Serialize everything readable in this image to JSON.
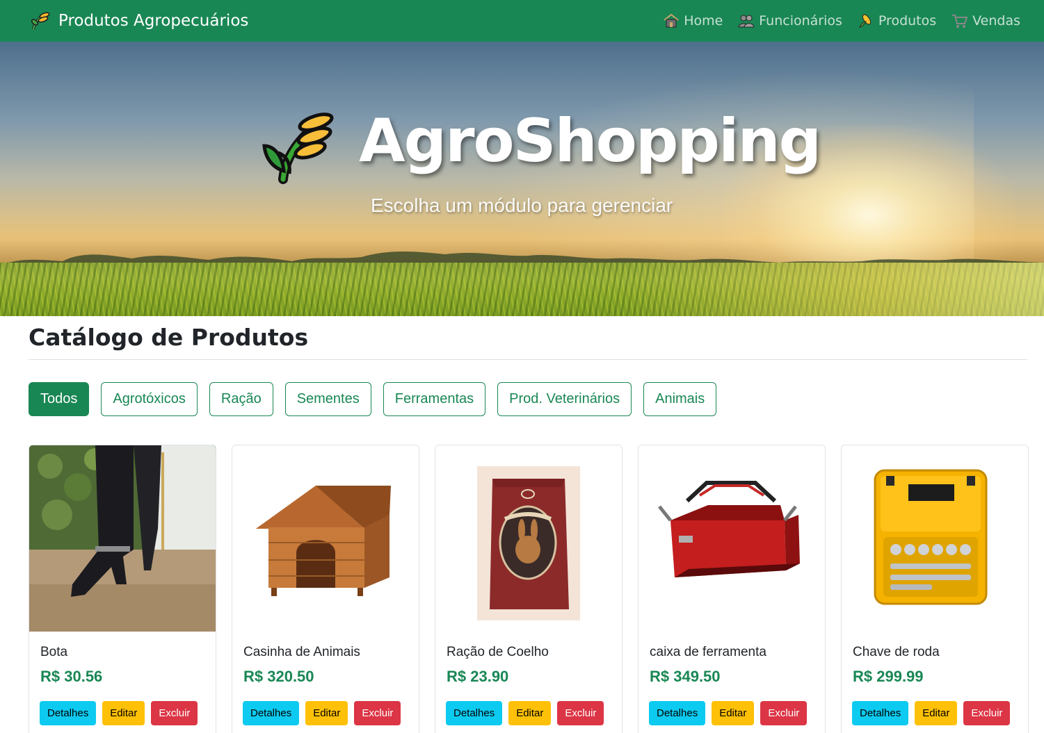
{
  "navbar": {
    "brand": "Produtos Agropecuários",
    "links": [
      {
        "label": "Home",
        "icon": "house-icon"
      },
      {
        "label": "Funcionários",
        "icon": "people-icon"
      },
      {
        "label": "Produtos",
        "icon": "corn-icon"
      },
      {
        "label": "Vendas",
        "icon": "cart-icon"
      }
    ]
  },
  "hero": {
    "title": "AgroShopping",
    "subtitle": "Escolha um módulo para gerenciar"
  },
  "catalog": {
    "title": "Catálogo de Produtos",
    "filters": [
      "Todos",
      "Agrotóxicos",
      "Ração",
      "Sementes",
      "Ferramentas",
      "Prod. Veterinários",
      "Animais"
    ],
    "active_filter": "Todos"
  },
  "products": [
    {
      "name": "Bota",
      "price": "R$ 30.56",
      "image": "boot-photo"
    },
    {
      "name": "Casinha de Animais",
      "price": "R$ 320.50",
      "image": "doghouse-photo"
    },
    {
      "name": "Ração de Coelho",
      "price": "R$ 23.90",
      "image": "rabbit-feed-photo"
    },
    {
      "name": "caixa de ferramenta",
      "price": "R$ 349.50",
      "image": "toolbox-photo"
    },
    {
      "name": "Chave de roda",
      "price": "R$ 299.99",
      "image": "socket-set-photo"
    }
  ],
  "card_actions": {
    "details": "Detalhes",
    "edit": "Editar",
    "delete": "Excluir"
  },
  "colors": {
    "primary": "#198754",
    "info": "#0dcaf0",
    "warning": "#ffc107",
    "danger": "#dc3545"
  }
}
